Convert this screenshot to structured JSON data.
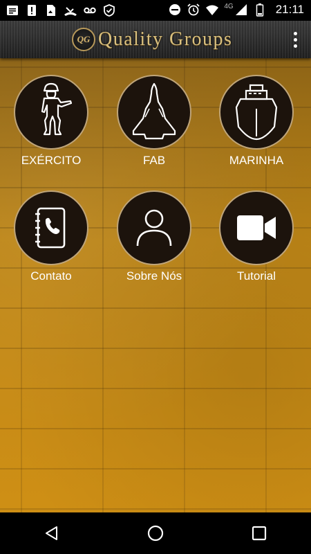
{
  "status_bar": {
    "time": "21:11",
    "network": "4G",
    "left_icons": [
      "message-icon",
      "alert-icon",
      "file-icon",
      "missed-call-icon",
      "voicemail-icon",
      "shield-icon"
    ],
    "right_icons": [
      "do-not-disturb-icon",
      "alarm-icon",
      "wifi-icon",
      "signal-icon",
      "battery-icon"
    ]
  },
  "app_bar": {
    "logo_badge": "QG",
    "title": "Quality Groups",
    "menu_icon": "more-vertical-icon"
  },
  "tiles": [
    {
      "label": "EXÉRCITO",
      "icon": "soldier-icon"
    },
    {
      "label": "FAB",
      "icon": "fighter-jet-icon"
    },
    {
      "label": "MARINHA",
      "icon": "ship-icon"
    },
    {
      "label": "Contato",
      "icon": "contact-book-icon"
    },
    {
      "label": "Sobre Nós",
      "icon": "person-icon"
    },
    {
      "label": "Tutorial",
      "icon": "video-camera-icon"
    }
  ],
  "nav_bar": {
    "back_icon": "back-icon",
    "home_icon": "home-icon",
    "recents_icon": "recents-icon"
  },
  "colors": {
    "background": "#c88d18",
    "tile_fill": "#1c130c",
    "tile_border": "#bfa57a",
    "logo_gold": "#d9c07e"
  }
}
